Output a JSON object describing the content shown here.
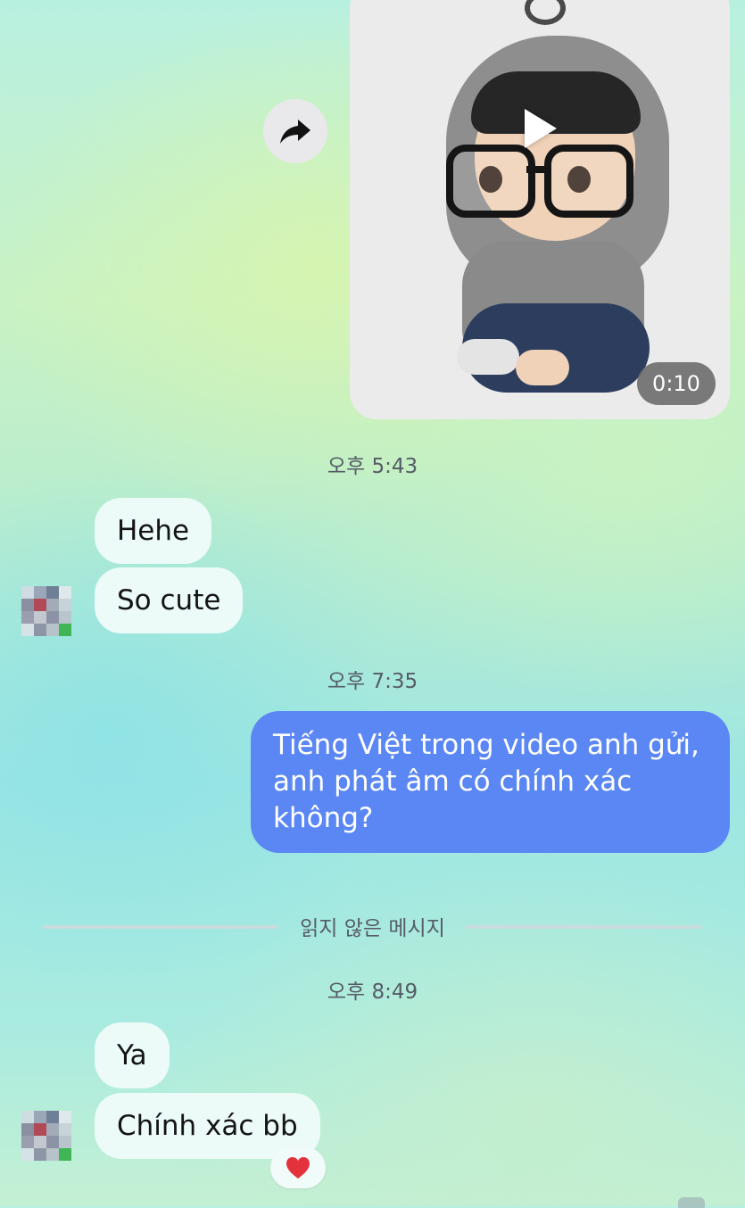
{
  "video_message": {
    "duration": "0:10",
    "thumbnail_icon": "chibi-hoodie-figure",
    "play_icon": "play-icon"
  },
  "share": {
    "icon": "share-arrow-icon"
  },
  "timestamps": {
    "t1": "오후 5:43",
    "t2": "오후 7:35",
    "t3": "오후 8:49"
  },
  "messages_group1": [
    "Hehe",
    "So cute"
  ],
  "outgoing_message": "Tiếng Việt trong video anh gửi, anh phát âm có chính xác không?",
  "divider": "읽지 않은 메시지",
  "messages_group2": [
    "Ya",
    "Chính xác bb"
  ],
  "reaction": {
    "emoji": "heart",
    "color": "#e4323c"
  },
  "colors": {
    "outgoing_bubble": "#5b87f4",
    "incoming_bubble": "#ecfbf8",
    "timestamp_text": "#565c66"
  }
}
